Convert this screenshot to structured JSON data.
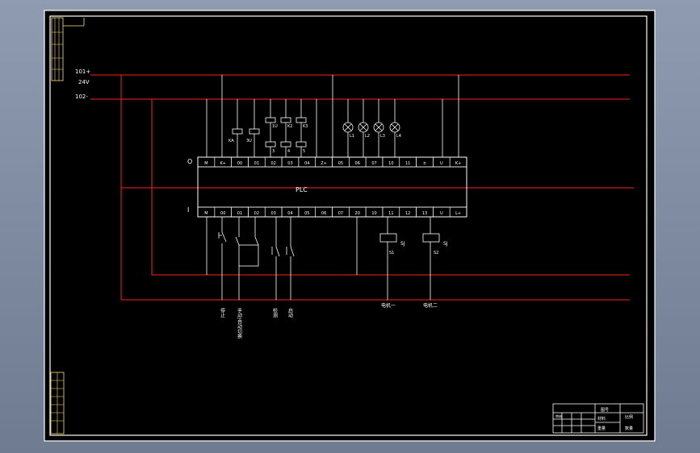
{
  "rails": {
    "top_label": "101+",
    "voltage_label": "24V",
    "bottom_label": "102-"
  },
  "plc": {
    "label": "PLC",
    "output_side_label": "O",
    "input_side_label": "I",
    "output_terminals": [
      "M",
      "K+",
      "00",
      "01",
      "02",
      "03",
      "04",
      "Z+",
      "05",
      "06",
      "07",
      "10",
      "11",
      "±",
      "U",
      "K+"
    ],
    "input_terminals": [
      "M",
      "00",
      "01",
      "02",
      "03",
      "04",
      "05",
      "06",
      "07",
      "20",
      "10",
      "11",
      "12",
      "13",
      "U",
      "L+"
    ]
  },
  "outputs": {
    "relays_left": [
      "KA",
      "3U"
    ],
    "relays_mid_top": [
      "1U",
      "K2",
      "K3"
    ],
    "relays_mid_bottom": [
      "3",
      "4",
      "5"
    ],
    "lamps": [
      "L1",
      "L2",
      "L3",
      "L4"
    ]
  },
  "inputs": {
    "timer_label": "SJ",
    "timer_contacts": [
      "S1",
      "S2"
    ],
    "bottom_labels": [
      "停止",
      "手动/自动切换",
      "检测",
      "启动"
    ],
    "motor_labels": [
      "电机一",
      "电机二"
    ]
  },
  "title_block": {
    "cells": [
      "图号",
      "比例",
      "材料",
      "重量",
      "数量",
      "审核"
    ]
  },
  "colors": {
    "frame": "#ffffff",
    "rail": "#ff2020",
    "line": "#ffffff",
    "label": "#ffe070",
    "background": "#000000"
  }
}
